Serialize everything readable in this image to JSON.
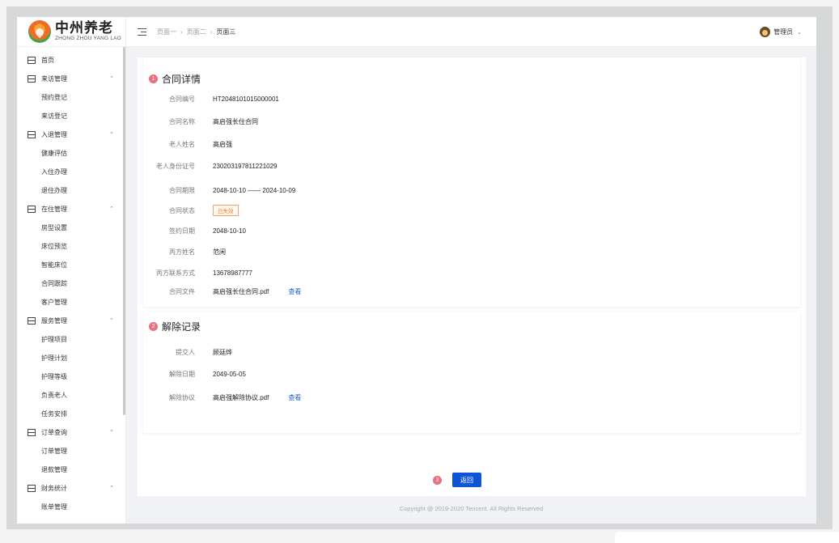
{
  "logo": {
    "cn": "中州养老",
    "en": "ZHONG ZHOU YANG LAO"
  },
  "breadcrumb": [
    "页面一",
    "页面二",
    "页面三"
  ],
  "breadcrumb_separator": "›",
  "user": {
    "name": "管理员",
    "chevron": "⌄"
  },
  "menu": [
    {
      "label": "首页",
      "expandable": false,
      "items": []
    },
    {
      "label": "来访管理",
      "expandable": true,
      "items": [
        "预约登记",
        "来访登记"
      ]
    },
    {
      "label": "入退管理",
      "expandable": true,
      "items": [
        "健康评估",
        "入住办理",
        "退住办理"
      ]
    },
    {
      "label": "在住管理",
      "expandable": true,
      "items": [
        "房型设置",
        "床位预览",
        "智能床位",
        "合同跟踪",
        "客户管理"
      ]
    },
    {
      "label": "服务管理",
      "expandable": true,
      "items": [
        "护理项目",
        "护理计划",
        "护理等级",
        "负责老人",
        "任务安排"
      ]
    },
    {
      "label": "订单查询",
      "expandable": true,
      "items": [
        "订单管理",
        "退款管理"
      ]
    },
    {
      "label": "财务统计",
      "expandable": true,
      "items": [
        "账单管理"
      ]
    }
  ],
  "menu_chevron": "⌃",
  "contract": {
    "badge": "1",
    "title": "合同详情",
    "rows": [
      {
        "label": "合同编号",
        "value": "HT2048101015000001"
      },
      {
        "label": "合同名称",
        "value": "高启强长住合同"
      },
      {
        "label": "老人姓名",
        "value": "高启强"
      },
      {
        "label": "老人身份证号",
        "value": "230203197811221029"
      },
      {
        "label": "合同期限",
        "value": "2048-10-10 —— 2024-10-09"
      },
      {
        "label": "合同状态",
        "tag": "已失效"
      },
      {
        "label": "签约日期",
        "value": "2048-10-10"
      },
      {
        "label": "丙方姓名",
        "value": "范闲"
      },
      {
        "label": "丙方联系方式",
        "value": "13678987777"
      },
      {
        "label": "合同文件",
        "value": "高启强长住合同.pdf",
        "link": "查看"
      }
    ]
  },
  "termination": {
    "badge": "2",
    "title": "解除记录",
    "rows": [
      {
        "label": "提交人",
        "value": "顾廷烨"
      },
      {
        "label": "解除日期",
        "value": "2049-05-05"
      },
      {
        "label": "解除协议",
        "value": "高启强解除协议.pdf",
        "link": "查看"
      }
    ]
  },
  "actions": {
    "badge": "3",
    "return_label": "返回"
  },
  "footer": "Copyright @ 2019-2020 Tencent. All Rights Reserved",
  "colors": {
    "primary": "#0d54d6",
    "badge": "#e9707d",
    "tag": "#f07b2a",
    "link": "#1f5fd1"
  }
}
